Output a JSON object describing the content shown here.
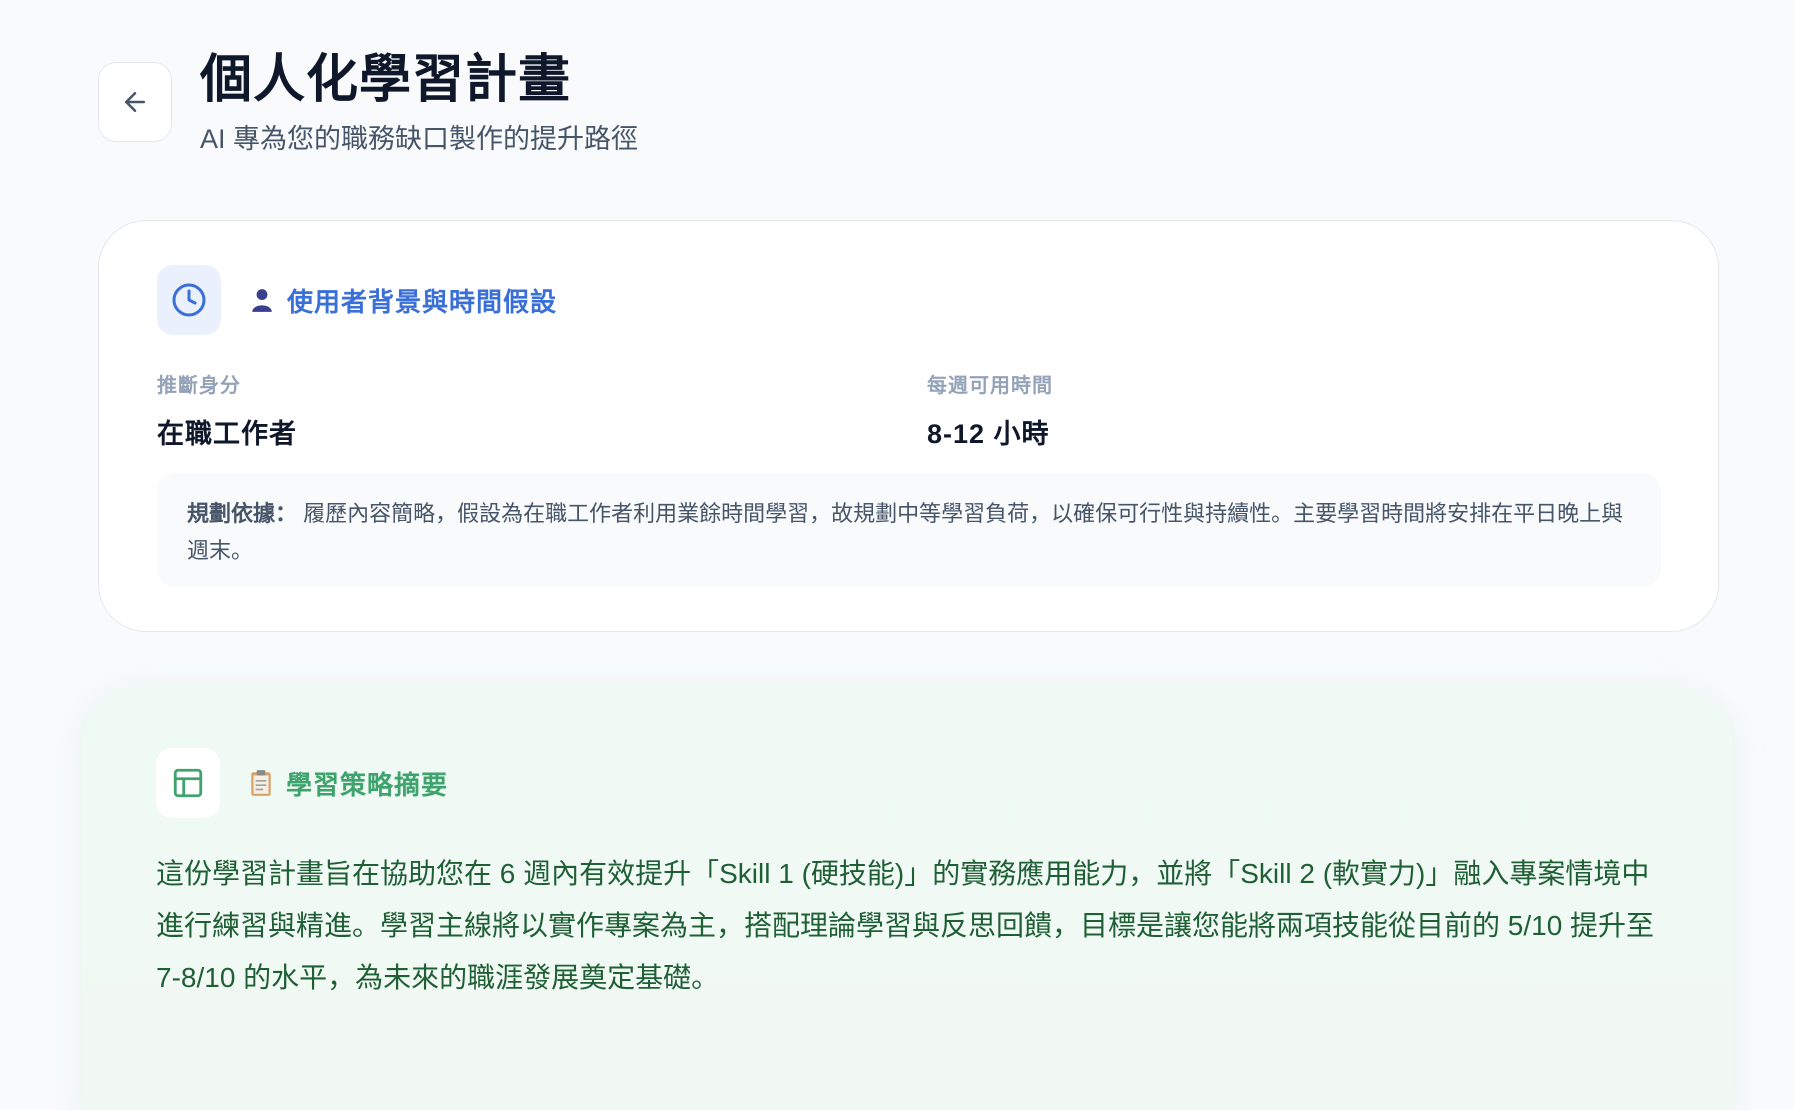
{
  "header": {
    "title": "個人化學習計畫",
    "subtitle": "AI 專為您的職務缺口製作的提升路徑"
  },
  "background_card": {
    "title": "使用者背景與時間假設",
    "identity_label": "推斷身分",
    "identity_value": "在職工作者",
    "time_label": "每週可用時間",
    "time_value": "8-12 小時",
    "basis_label": "規劃依據：",
    "basis_text": "履歷內容簡略，假設為在職工作者利用業餘時間學習，故規劃中等學習負荷，以確保可行性與持續性。主要學習時間將安排在平日晚上與週末。"
  },
  "strategy_card": {
    "title": "學習策略摘要",
    "summary": "這份學習計畫旨在協助您在 6 週內有效提升「Skill 1 (硬技能)」的實務應用能力，並將「Skill 2 (軟實力)」融入專案情境中進行練習與精進。學習主線將以實作專案為主，搭配理論學習與反思回饋，目標是讓您能將兩項技能從目前的 5/10 提升至 7-8/10 的水平，為未來的職涯發展奠定基礎。"
  },
  "icons": {
    "back": "arrow-left-icon",
    "clock": "clock-icon",
    "user": "user-silhouette-icon",
    "layout": "layout-icon",
    "clipboard": "clipboard-icon"
  },
  "colors": {
    "accent_blue": "#3b6fd8",
    "accent_green": "#3ea36d",
    "strategy_text": "#1f5f36"
  }
}
